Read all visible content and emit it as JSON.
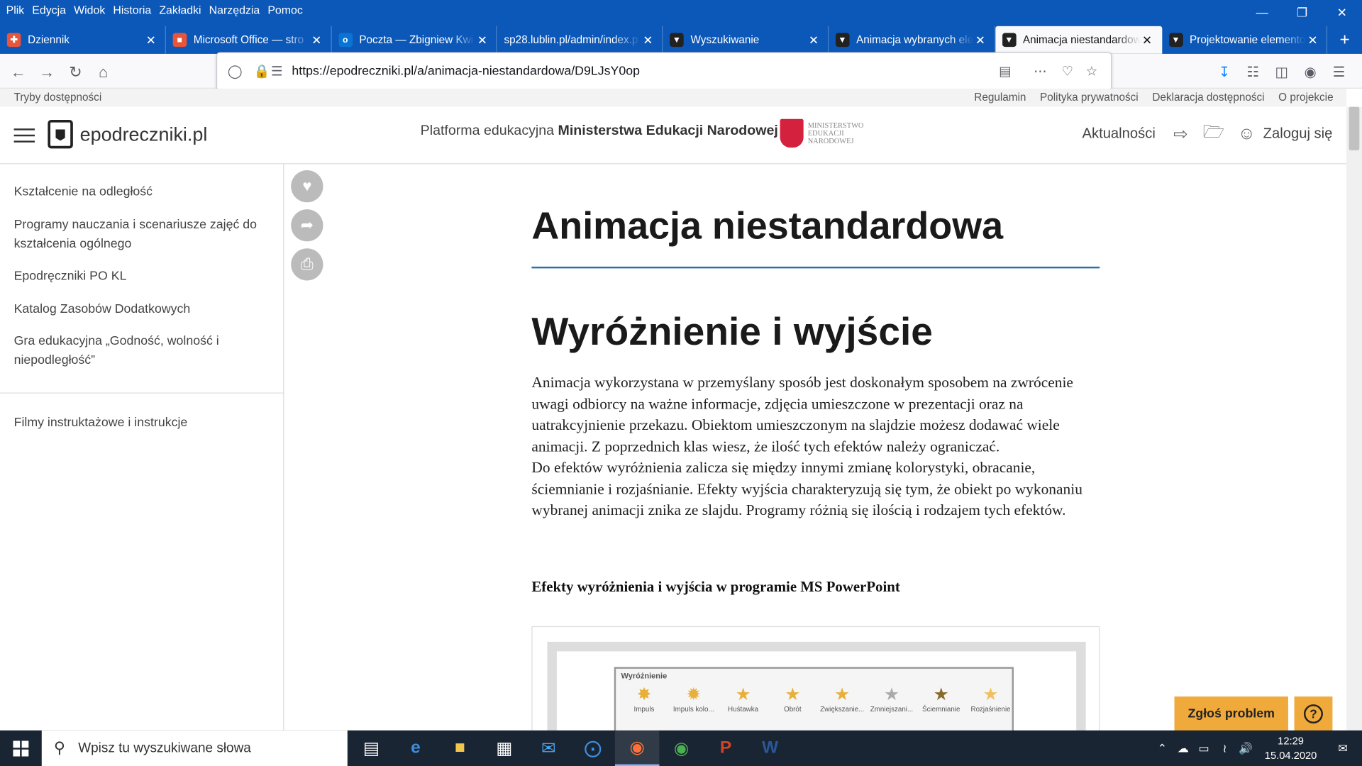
{
  "browser": {
    "menu": [
      "Plik",
      "Edycja",
      "Widok",
      "Historia",
      "Zakładki",
      "Narzędzia",
      "Pomoc"
    ],
    "tabs": [
      {
        "label": "Dziennik",
        "icon": "dziennik-icon",
        "color": "#e8553a"
      },
      {
        "label": "Microsoft Office — stro",
        "icon": "office-icon",
        "color": "#e8553a"
      },
      {
        "label": "Poczta — Zbigniew Kwi",
        "icon": "outlook-icon",
        "color": "#0a74d4"
      },
      {
        "label": "sp28.lublin.pl/admin/index.p",
        "icon": "page-icon",
        "color": "#ffffff"
      },
      {
        "label": "Wyszukiwanie",
        "icon": "epodreczniki-icon",
        "color": "#222222"
      },
      {
        "label": "Animacja wybranych ele",
        "icon": "epodreczniki-icon",
        "color": "#222222"
      },
      {
        "label": "Animacja niestandardow",
        "icon": "epodreczniki-icon",
        "color": "#222222"
      },
      {
        "label": "Projektowanie elemento",
        "icon": "epodreczniki-icon",
        "color": "#222222"
      }
    ],
    "active_tab": 6,
    "url": "https://epodreczniki.pl/a/animacja-niestandardowa/D9LJsY0op"
  },
  "site": {
    "access_left": "Tryby dostępności",
    "access_links": [
      "Regulamin",
      "Polityka prywatności",
      "Deklaracja dostępności",
      "O projekcie"
    ],
    "logo": "epodreczniki.pl",
    "platform_prefix": "Platforma edukacyjna ",
    "platform_bold": "Ministerstwa Edukacji Narodowej",
    "ministry": [
      "MINISTERSTWO",
      "EDUKACJI",
      "NARODOWEJ"
    ],
    "news": "Aktualności",
    "login": "Zaloguj się"
  },
  "sidebar": {
    "items": [
      "Kształcenie na odległość",
      "Programy nauczania i scenariusze zajęć do kształcenia ogólnego",
      "Epodręczniki PO KL",
      "Katalog Zasobów Dodatkowych",
      "Gra edukacyjna „Godność, wolność i niepodległość”",
      "Filmy instruktażowe i instrukcje"
    ]
  },
  "article": {
    "title": "Animacja niestandardowa",
    "heading": "Wyróżnienie i wyjście",
    "paragraph1": "Animacja wykorzystana w przemyślany sposób jest doskonałym sposobem na zwrócenie uwagi odbiorcy na ważne informacje, zdjęcia umieszczone w prezentacji oraz na uatrakcyjnienie przekazu. Obiektom umieszczonym na slajdzie możesz dodawać wiele animacji. Z poprzednich klas wiesz, że ilość tych efektów należy ograniczać.",
    "paragraph2": "Do efektów wyróżnienia zalicza się między innymi zmianę kolorystyki, obracanie, ściemnianie i rozjaśnianie. Efekty wyjścia charakteryzują się tym, że obiekt po wykonaniu wybranej animacji znika ze slajdu. Programy różnią się ilością i rodzajem tych efektów.",
    "subheading": "Efekty wyróżnienia i wyjścia w programie MS PowerPoint",
    "figure": {
      "panel_title": "Wyróżnienie",
      "effects": [
        "Impuls",
        "Impuls kolo...",
        "Huśtawka",
        "Obrót",
        "Zwiększanie...",
        "Zmniejszani...",
        "Ściemnianie",
        "Rozjaśnienie"
      ]
    }
  },
  "buttons": {
    "report": "Zgłoś problem",
    "help": "?"
  },
  "taskbar": {
    "search_placeholder": "Wpisz tu wyszukiwane słowa",
    "time": "12:29",
    "date": "15.04.2020"
  },
  "colors": {
    "titlebar": "#0c58b8",
    "accent_rule": "#2d6fa8",
    "report_button": "#f0a93b",
    "taskbar": "#1a2533"
  }
}
